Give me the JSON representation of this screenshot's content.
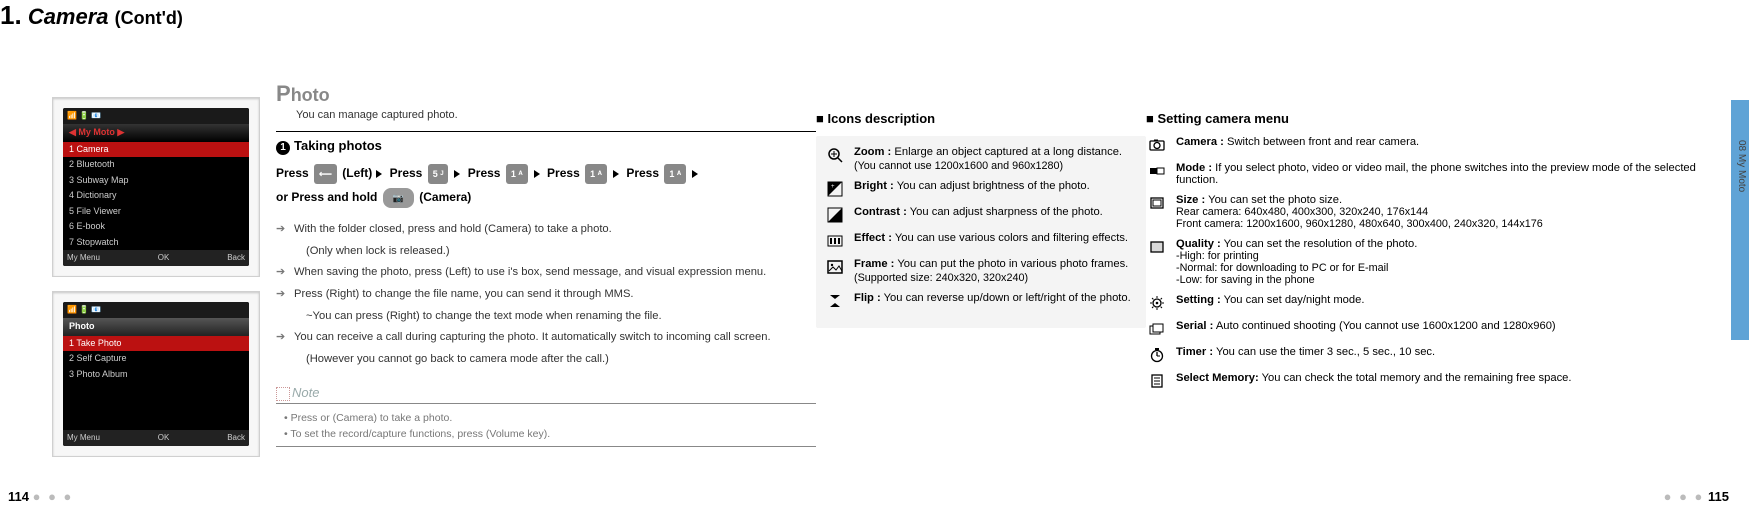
{
  "title": {
    "num": "1.",
    "main": "Camera",
    "contd": "(Cont'd)"
  },
  "side_tab": "08  My Moto",
  "page_left": "114",
  "page_right": "115",
  "phone1": {
    "title": "My Moto",
    "rows": [
      "Camera",
      "Bluetooth",
      "Subway Map",
      "Dictionary",
      "File Viewer",
      "E-book",
      "Stopwatch"
    ],
    "soft": [
      "My Menu",
      "OK",
      "Back"
    ]
  },
  "phone2": {
    "title": "Photo",
    "rows": [
      "Take Photo",
      "Self Capture",
      "Photo Album"
    ],
    "soft": [
      "My Menu",
      "OK",
      "Back"
    ]
  },
  "photo": {
    "heading_cap": "P",
    "heading_rest": "hoto",
    "sub": "You can manage captured photo.",
    "taking": "Taking photos",
    "press_parts": {
      "press": "Press",
      "left": "(Left)",
      "press2": "Press",
      "press3": "Press",
      "press4": "Press",
      "press5": "Press",
      "or": "or Press and hold",
      "camera": "(Camera)"
    },
    "arrows": [
      "With the folder closed, press and hold            (Camera) to take a photo.",
      "(Only when lock is released.)",
      "When saving the photo, press        (Left) to use i's box, send message, and visual expression menu.",
      "Press         (Right) to change the file name, you can send it through MMS.",
      "~You can press        (Right) to change the text mode when renaming the file.",
      "You can receive a call during capturing the photo. It automatically switch to incoming call screen.",
      "(However you cannot go back to camera mode after the call.)"
    ],
    "note_title": "Note",
    "notes": [
      "Press        or               (Camera) to take a photo.",
      "To set the record/capture functions, press               (Volume key)."
    ]
  },
  "icons": {
    "heading": "Icons description",
    "items": [
      {
        "label": "Zoom :",
        "text": "Enlarge an object captured at a long distance.",
        "extra": "(You cannot use 1200x1600 and 960x1280)"
      },
      {
        "label": "Bright :",
        "text": "You can adjust brightness of the photo."
      },
      {
        "label": "Contrast :",
        "text": "You can adjust sharpness of the photo."
      },
      {
        "label": "Effect :",
        "text": "You can use various colors and filtering effects."
      },
      {
        "label": "Frame :",
        "text": "You can put the photo in various photo frames.",
        "extra": "(Supported size: 240x320, 320x240)"
      },
      {
        "label": "Flip :",
        "text": "You can reverse up/down or left/right of the photo."
      }
    ]
  },
  "settings": {
    "heading": "Setting camera menu",
    "items": [
      {
        "label": "Camera  :",
        "text": "Switch between front and rear camera."
      },
      {
        "label": "Mode :",
        "text": "If you select photo, video or video mail, the phone switches into the preview mode of the selected function."
      },
      {
        "label": "Size :",
        "text": "You can set the photo size.",
        "extra": "Rear camera: 640x480, 400x300, 320x240, 176x144",
        "extra2": "Front camera: 1200x1600, 960x1280, 480x640, 300x400, 240x320, 144x176"
      },
      {
        "label": "Quality :",
        "text": "You can set the resolution of the photo.",
        "extra": "-High: for printing",
        "extra2": "-Normal: for downloading to PC or for E-mail",
        "extra3": "-Low: for saving in the phone"
      },
      {
        "label": "Setting :",
        "text": "You can set day/night mode."
      },
      {
        "label": "Serial :",
        "text": "Auto continued shooting (You cannot use 1600x1200 and 1280x960)"
      },
      {
        "label": "Timer :",
        "text": "You can use the timer 3 sec., 5 sec., 10 sec."
      },
      {
        "label": "Select Memory:",
        "text": "You can check the total memory and the remaining free space."
      }
    ]
  }
}
